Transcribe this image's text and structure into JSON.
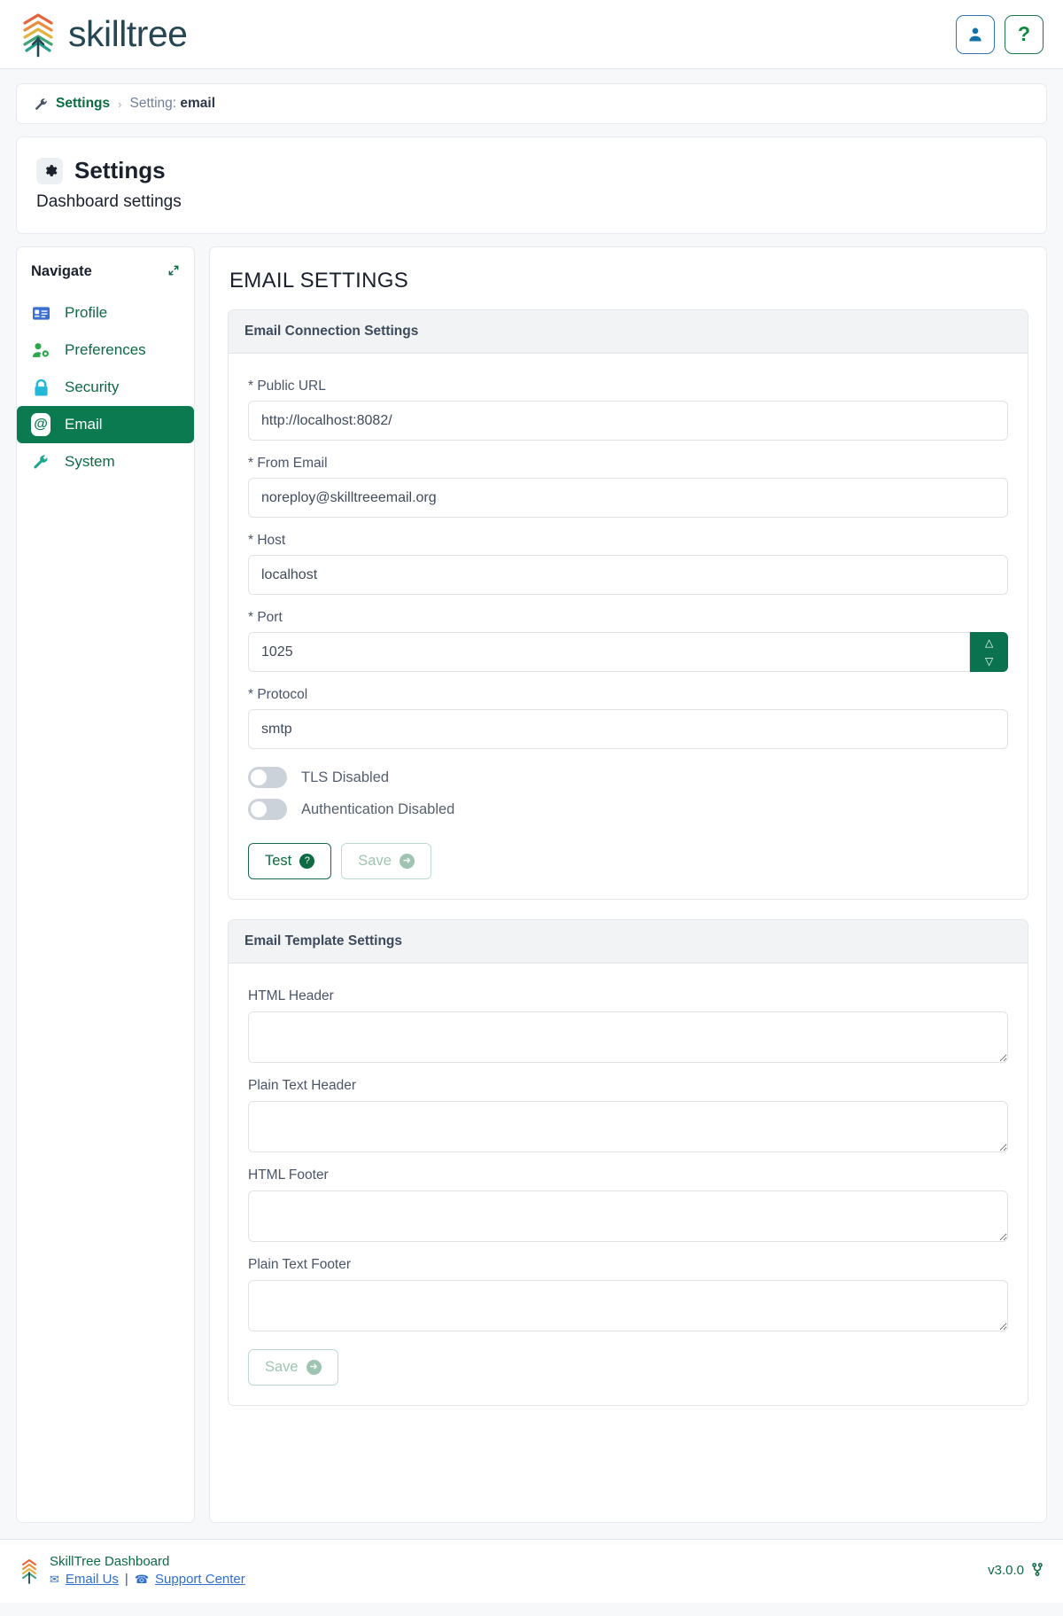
{
  "header": {
    "brand": "skilltree",
    "logo_colors": [
      "#e8633a",
      "#eb8c3c",
      "#e3b23c",
      "#3fa37a",
      "#2a9d8f"
    ],
    "user_button_icon": "user-icon",
    "help_button_icon": "question-mark-icon",
    "help_label": "?"
  },
  "breadcrumb": {
    "wrench_icon": "wrench-icon",
    "root": "Settings",
    "separator": "›",
    "current_prefix": "Setting: ",
    "current_value": "email"
  },
  "page": {
    "gear_icon": "gear-icon",
    "title": "Settings",
    "subtitle": "Dashboard settings"
  },
  "sidebar": {
    "title": "Navigate",
    "collapse_icon": "collapse-arrows-icon",
    "items": [
      {
        "label": "Profile",
        "icon": "id-card-icon",
        "color": "#3b6fd4",
        "active": false
      },
      {
        "label": "Preferences",
        "icon": "user-gear-icon",
        "color": "#2aa84a",
        "active": false
      },
      {
        "label": "Security",
        "icon": "lock-icon",
        "color": "#24b8d8",
        "active": false
      },
      {
        "label": "Email",
        "icon": "at-icon",
        "color": "#ffffff",
        "active": true
      },
      {
        "label": "System",
        "icon": "wrench-icon",
        "color": "#1aa88a",
        "active": false
      }
    ]
  },
  "main": {
    "section_title": "EMAIL SETTINGS",
    "connection_panel": {
      "heading": "Email Connection Settings",
      "fields": [
        {
          "label": "* Public URL",
          "value": "http://localhost:8082/",
          "type": "text"
        },
        {
          "label": "* From Email",
          "value": "noreploy@skilltreeemail.org",
          "type": "text"
        },
        {
          "label": "* Host",
          "value": "localhost",
          "type": "text"
        },
        {
          "label": "* Port",
          "value": "1025",
          "type": "number"
        },
        {
          "label": "* Protocol",
          "value": "smtp",
          "type": "text"
        }
      ],
      "toggles": [
        {
          "label": "TLS Disabled",
          "on": false
        },
        {
          "label": "Authentication Disabled",
          "on": false
        }
      ],
      "buttons": [
        {
          "label": "Test",
          "icon": "question-circle-icon",
          "glyph": "?",
          "disabled": false
        },
        {
          "label": "Save",
          "icon": "arrow-circle-right-icon",
          "glyph": "➜",
          "disabled": true
        }
      ]
    },
    "template_panel": {
      "heading": "Email Template Settings",
      "fields": [
        {
          "label": "HTML Header",
          "value": ""
        },
        {
          "label": "Plain Text Header",
          "value": ""
        },
        {
          "label": "HTML Footer",
          "value": ""
        },
        {
          "label": "Plain Text Footer",
          "value": ""
        }
      ],
      "save_button": {
        "label": "Save",
        "glyph": "➜",
        "disabled": true
      }
    }
  },
  "footer": {
    "app_name": "SkillTree Dashboard",
    "email_icon": "envelope-icon",
    "email_link": "Email Us",
    "pipe": "|",
    "phone_icon": "phone-icon",
    "support_link": "Support Center",
    "version": "v3.0.0",
    "version_icon": "branch-icon"
  }
}
